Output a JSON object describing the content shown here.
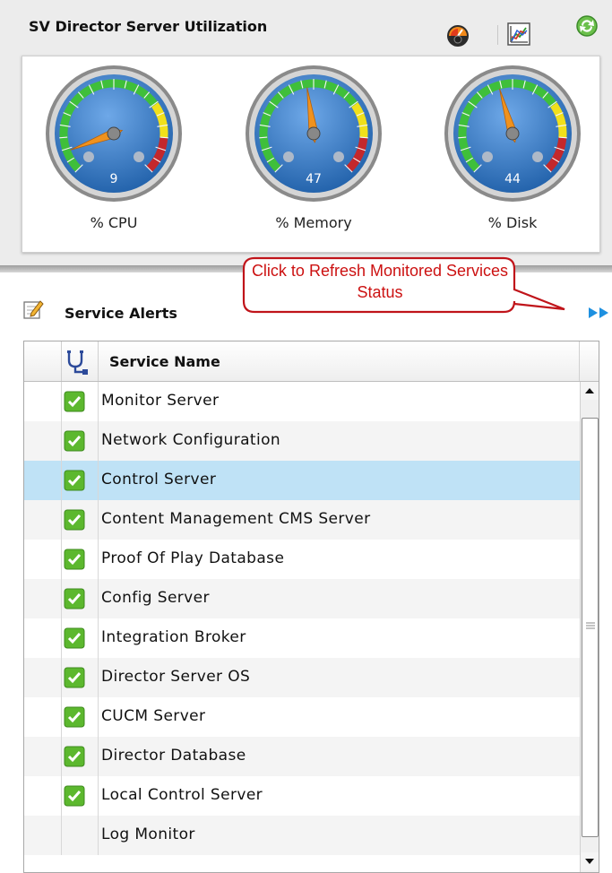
{
  "utilization": {
    "title": "SV Director Server Utilization",
    "gauges": [
      {
        "label": "% CPU",
        "value": "9",
        "percent": 9
      },
      {
        "label": "% Memory",
        "value": "47",
        "percent": 47
      },
      {
        "label": "% Disk",
        "value": "44",
        "percent": 44
      }
    ],
    "icons": [
      "dashboard-gauge-icon",
      "chart-icon",
      "refresh-icon"
    ]
  },
  "alerts": {
    "title": "Service Alerts",
    "callout": "Click to Refresh Monitored Services Status",
    "column_header": "Service Name",
    "rows": [
      {
        "name": "Monitor Server",
        "ok": true
      },
      {
        "name": "Network Configuration",
        "ok": true
      },
      {
        "name": "Control Server",
        "ok": true,
        "selected": true
      },
      {
        "name": "Content Management CMS Server",
        "ok": true
      },
      {
        "name": "Proof Of Play Database",
        "ok": true
      },
      {
        "name": "Config Server",
        "ok": true
      },
      {
        "name": "Integration Broker",
        "ok": true
      },
      {
        "name": "Director Server OS",
        "ok": true
      },
      {
        "name": "CUCM Server",
        "ok": true
      },
      {
        "name": "Director Database",
        "ok": true
      },
      {
        "name": "Local Control Server",
        "ok": true
      },
      {
        "name": "Log Monitor",
        "ok": false
      }
    ]
  },
  "colors": {
    "selected_row": "#bfe2f6",
    "check_green": "#5cb82e",
    "callout_red": "#cc1111",
    "gauge_blue": "#1f5fa8"
  }
}
